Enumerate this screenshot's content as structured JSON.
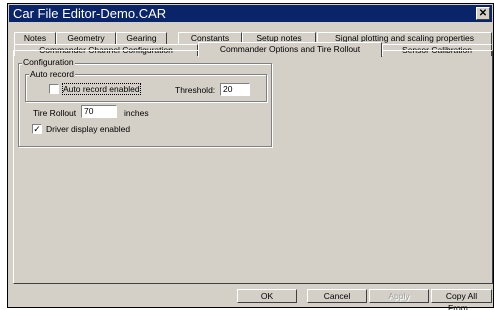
{
  "window": {
    "title": "Car File Editor-Demo.CAR",
    "close_glyph": "✕"
  },
  "tabs_row1": [
    {
      "label": "Notes"
    },
    {
      "label": "Geometry"
    },
    {
      "label": "Gearing"
    },
    {
      "label": "Constants"
    },
    {
      "label": "Setup notes"
    },
    {
      "label": "Signal plotting and scaling properties"
    }
  ],
  "tabs_row2": [
    {
      "label": "Commander Channel Configuration"
    },
    {
      "label": "Commander Options and Tire Rollout",
      "active": true
    },
    {
      "label": "Sensor Calibration"
    }
  ],
  "configuration": {
    "legend": "Configuration",
    "auto_record": {
      "legend": "Auto record",
      "checkbox_label": "Auto record enabled",
      "checked": false,
      "threshold_label": "Threshold:",
      "threshold_value": "20"
    },
    "tire_rollout": {
      "label": "Tire Rollout",
      "value": "70",
      "units": "inches"
    },
    "driver_display": {
      "label": "Driver display enabled",
      "checked": true,
      "check_glyph": "✓"
    }
  },
  "buttons": {
    "ok": "OK",
    "cancel": "Cancel",
    "apply": "Apply",
    "copy_all": "Copy All From..."
  }
}
